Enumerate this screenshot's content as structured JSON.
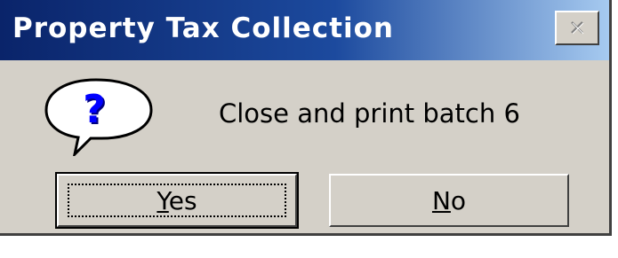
{
  "window": {
    "title": "Property Tax Collection",
    "close_icon": "close-icon"
  },
  "dialog": {
    "icon": "question-balloon-icon",
    "message": "Close and print batch 6"
  },
  "buttons": {
    "yes": {
      "mnemonic": "Y",
      "rest": "es"
    },
    "no": {
      "mnemonic": "N",
      "rest": "o"
    }
  },
  "colors": {
    "titlebar_start": "#0a246a",
    "titlebar_end": "#a6caf0",
    "face": "#d4d0c8",
    "icon_question": "#0000ff"
  }
}
